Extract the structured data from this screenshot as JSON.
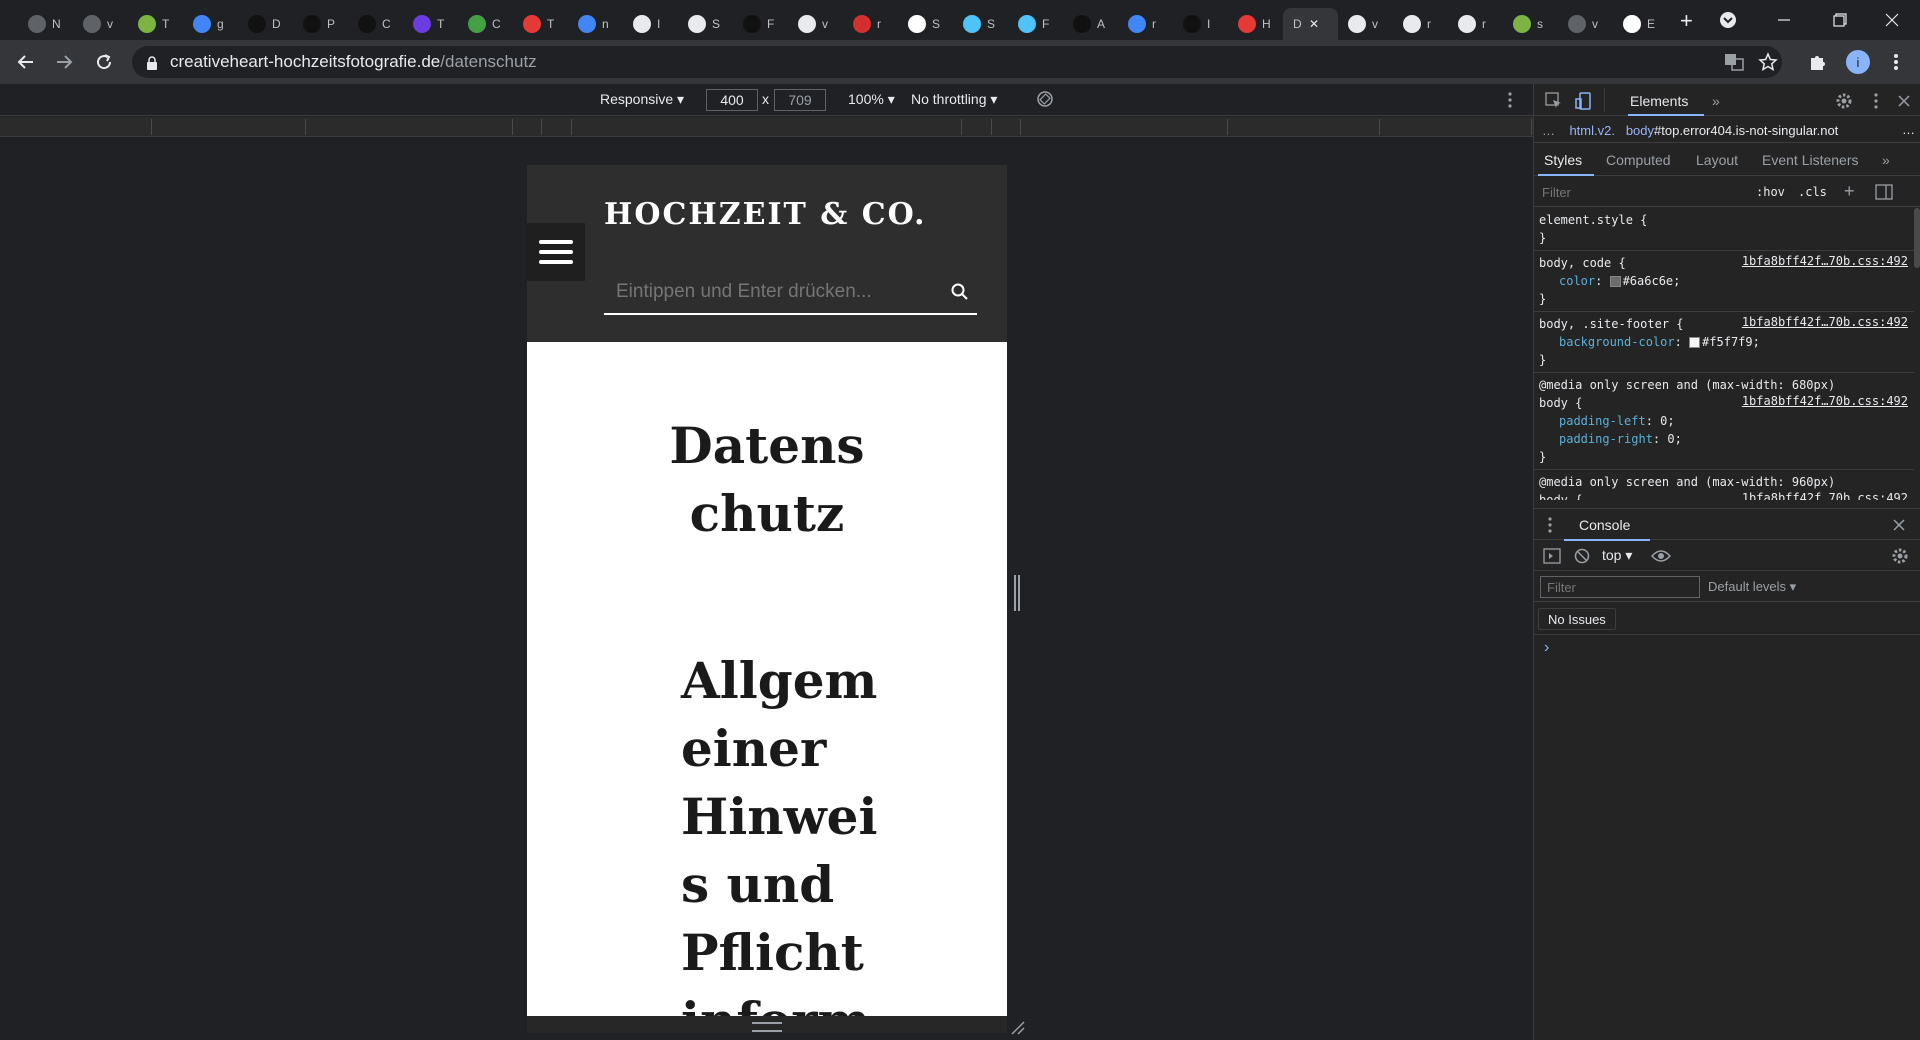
{
  "browser": {
    "tabs": [
      {
        "letter": "N",
        "icon": "globe-icon",
        "color": "#5f6368"
      },
      {
        "letter": "v",
        "icon": "globe-icon",
        "color": "#5f6368"
      },
      {
        "letter": "T",
        "icon": "plant-icon",
        "color": "#7cb342"
      },
      {
        "letter": "g",
        "icon": "google-icon",
        "color": "#4285f4"
      },
      {
        "letter": "D",
        "icon": "dev-icon",
        "color": "#111111"
      },
      {
        "letter": "P",
        "icon": "dev-icon",
        "color": "#111111"
      },
      {
        "letter": "C",
        "icon": "dev-icon",
        "color": "#111111"
      },
      {
        "letter": "T",
        "icon": "dev-purple-icon",
        "color": "#6c3ce0"
      },
      {
        "letter": "C",
        "icon": "leaf-icon",
        "color": "#43a047"
      },
      {
        "letter": "T",
        "icon": "target-icon",
        "color": "#e53935"
      },
      {
        "letter": "n",
        "icon": "google-icon",
        "color": "#4285f4"
      },
      {
        "letter": "I",
        "icon": "github-icon",
        "color": "#e8eaed"
      },
      {
        "letter": "S",
        "icon": "github-icon",
        "color": "#e8eaed"
      },
      {
        "letter": "F",
        "icon": "dark-circle-icon",
        "color": "#111111"
      },
      {
        "letter": "v",
        "icon": "github-icon",
        "color": "#e8eaed"
      },
      {
        "letter": "r",
        "icon": "red-n-icon",
        "color": "#d32f2f"
      },
      {
        "letter": "S",
        "icon": "w-icon",
        "color": "#ffffff"
      },
      {
        "letter": "S",
        "icon": "image-icon",
        "color": "#4fc3f7"
      },
      {
        "letter": "F",
        "icon": "image-icon",
        "color": "#4fc3f7"
      },
      {
        "letter": "A",
        "icon": "wiki-icon",
        "color": "#111111"
      },
      {
        "letter": "r",
        "icon": "google-icon",
        "color": "#4285f4"
      },
      {
        "letter": "I",
        "icon": "dev-icon",
        "color": "#111111"
      },
      {
        "letter": "H",
        "icon": "heart-icon",
        "color": "#e53935"
      },
      {
        "letter": "D",
        "icon": "",
        "color": "",
        "active": true
      },
      {
        "letter": "v",
        "icon": "github-icon",
        "color": "#e8eaed"
      },
      {
        "letter": "r",
        "icon": "github-icon",
        "color": "#e8eaed"
      },
      {
        "letter": "r",
        "icon": "github-icon",
        "color": "#e8eaed"
      },
      {
        "letter": "s",
        "icon": "plant-icon",
        "color": "#7cb342"
      },
      {
        "letter": "v",
        "icon": "globe-icon",
        "color": "#5f6368"
      },
      {
        "letter": "E",
        "icon": "openai-icon",
        "color": "#ffffff"
      }
    ],
    "url_host": "creativeheart-hochzeitsfotografie.de",
    "url_path": "/datenschutz"
  },
  "device_toolbar": {
    "mode": "Responsive",
    "width": "400",
    "height": "709",
    "times": "x",
    "zoom": "100%",
    "throttling": "No throttling"
  },
  "site": {
    "title": "HOCHZEIT & CO.",
    "search_placeholder": "Eintippen und Enter drücken...",
    "page_title": "Datenschutz",
    "section_heading": "Allgemeiner Hinweis und Pflichtinform"
  },
  "devtools": {
    "main_tab": "Elements",
    "breadcrumb_ellipsis": "…",
    "breadcrumb_html": "html.v2.",
    "breadcrumb_body_tag": "body",
    "breadcrumb_body": "#top.error404.is-not-singular.not",
    "breadcrumb_more": "…",
    "style_tabs": [
      "Styles",
      "Computed",
      "Layout",
      "Event Listeners"
    ],
    "filter_placeholder": "Filter",
    "hov": ":hov",
    "cls": ".cls",
    "rules": [
      {
        "selector": "element.style {",
        "source": "",
        "props": [],
        "close": "}"
      },
      {
        "selector": "body, code {",
        "source": "1bfa8bff42f…70b.css:492",
        "props": [
          {
            "name": "color",
            "value": "#6a6c6e;",
            "swatch": "#6a6c6e"
          }
        ],
        "close": "}"
      },
      {
        "selector": "body, .site-footer {",
        "source": "1bfa8bff42f…70b.css:492",
        "props": [
          {
            "name": "background-color",
            "value": "#f5f7f9;",
            "swatch": "#f5f7f9"
          }
        ],
        "close": "}"
      },
      {
        "media": "@media only screen and (max-width: 680px)",
        "selector": "body {",
        "source": "1bfa8bff42f…70b.css:492",
        "props": [
          {
            "name": "padding-left",
            "value": "0;"
          },
          {
            "name": "padding-right",
            "value": "0;"
          }
        ],
        "close": "}"
      },
      {
        "media": "@media only screen and (max-width: 960px)",
        "selector": "body {",
        "source": "1bfa8bff42f…70b.css:492",
        "props": [],
        "close": ""
      }
    ],
    "console_title": "Console",
    "context": "top",
    "console_filter_placeholder": "Filter",
    "levels": "Default levels",
    "issues": "No Issues",
    "prompt": "›"
  }
}
